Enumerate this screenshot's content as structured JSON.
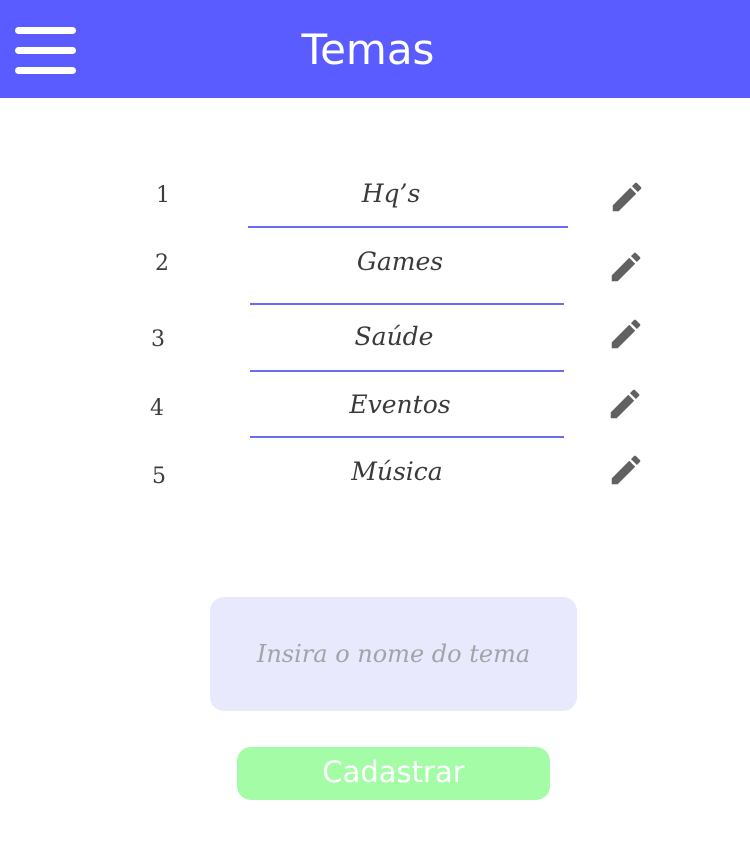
{
  "header": {
    "title": "Temas",
    "background": "#5a5cff",
    "menu_icon": "hamburger-menu-icon"
  },
  "themes": [
    {
      "number": "1",
      "name": "Hq’s"
    },
    {
      "number": "2",
      "name": "Games"
    },
    {
      "number": "3",
      "name": "Saúde"
    },
    {
      "number": "4",
      "name": "Eventos"
    },
    {
      "number": "5",
      "name": "Música"
    }
  ],
  "edit_icon": "pencil-icon",
  "form": {
    "input_placeholder": "Insira o nome do tema",
    "input_background": "#e8e9fd",
    "submit_label": "Cadastrar",
    "submit_background": "#a4fca7"
  },
  "divider_color": "#6a6cf2"
}
